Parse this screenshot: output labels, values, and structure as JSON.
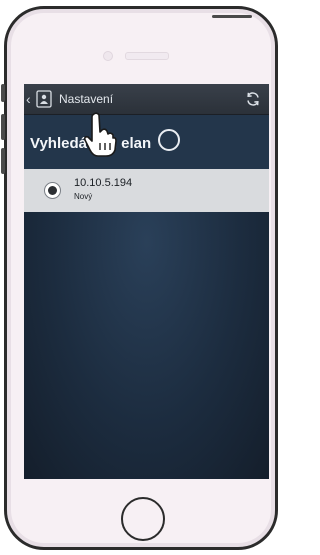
{
  "app": {
    "title": "Nastavení"
  },
  "search": {
    "label": "Vyhledávám elan"
  },
  "devices": [
    {
      "address": "10.10.5.194",
      "status": "Nový"
    }
  ],
  "icons": {
    "back": "chevron-left-icon",
    "app": "elan-device-icon",
    "refresh": "refresh-icon",
    "spinner": "loading-spinner-icon",
    "cursor": "hand-pointer-icon",
    "home": "home-button-icon"
  },
  "colors": {
    "topbar": "#343b44",
    "section": "#23364b",
    "list_item": "#d9dbde",
    "background": "#1c2c3f"
  }
}
